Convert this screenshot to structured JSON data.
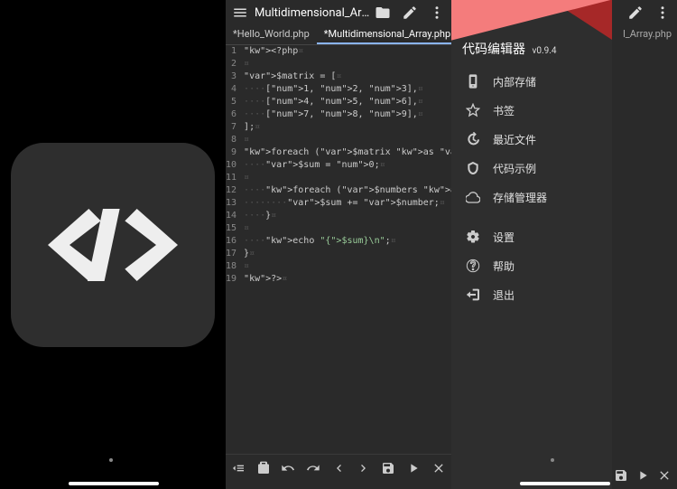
{
  "panel2": {
    "title": "Multidimensional_Array...",
    "tabs": [
      {
        "label": "*Hello_World.php",
        "active": false
      },
      {
        "label": "*Multidimensional_Array.php",
        "active": true
      }
    ],
    "code_lines": [
      "<?php",
      "",
      "$matrix = [",
      "    [1, 2, 3],",
      "    [4, 5, 6],",
      "    [7, 8, 9],",
      "];",
      "",
      "foreach ($matrix as $numbers) {",
      "    $sum = 0;",
      "",
      "    foreach ($numbers as $number) {",
      "        $sum += $number;",
      "    }",
      "",
      "    echo \"{$sum}\\n\";",
      "}",
      "",
      "?>"
    ]
  },
  "panel3": {
    "app_name": "代码编辑器",
    "version": "v0.9.4",
    "bg_tab": "l_Array.php",
    "drawer": [
      {
        "icon": "phone-icon",
        "label": "内部存储"
      },
      {
        "icon": "star-icon",
        "label": "书签"
      },
      {
        "icon": "history-icon",
        "label": "最近文件"
      },
      {
        "icon": "sample-icon",
        "label": "代码示例"
      },
      {
        "icon": "cloud-icon",
        "label": "存储管理器"
      }
    ],
    "drawer2": [
      {
        "icon": "gear-icon",
        "label": "设置"
      },
      {
        "icon": "help-icon",
        "label": "帮助"
      },
      {
        "icon": "exit-icon",
        "label": "退出"
      }
    ]
  },
  "bottombar_icons": [
    "indent",
    "clipboard",
    "undo",
    "redo",
    "arrow-left",
    "arrow-right",
    "save",
    "play",
    "close"
  ]
}
